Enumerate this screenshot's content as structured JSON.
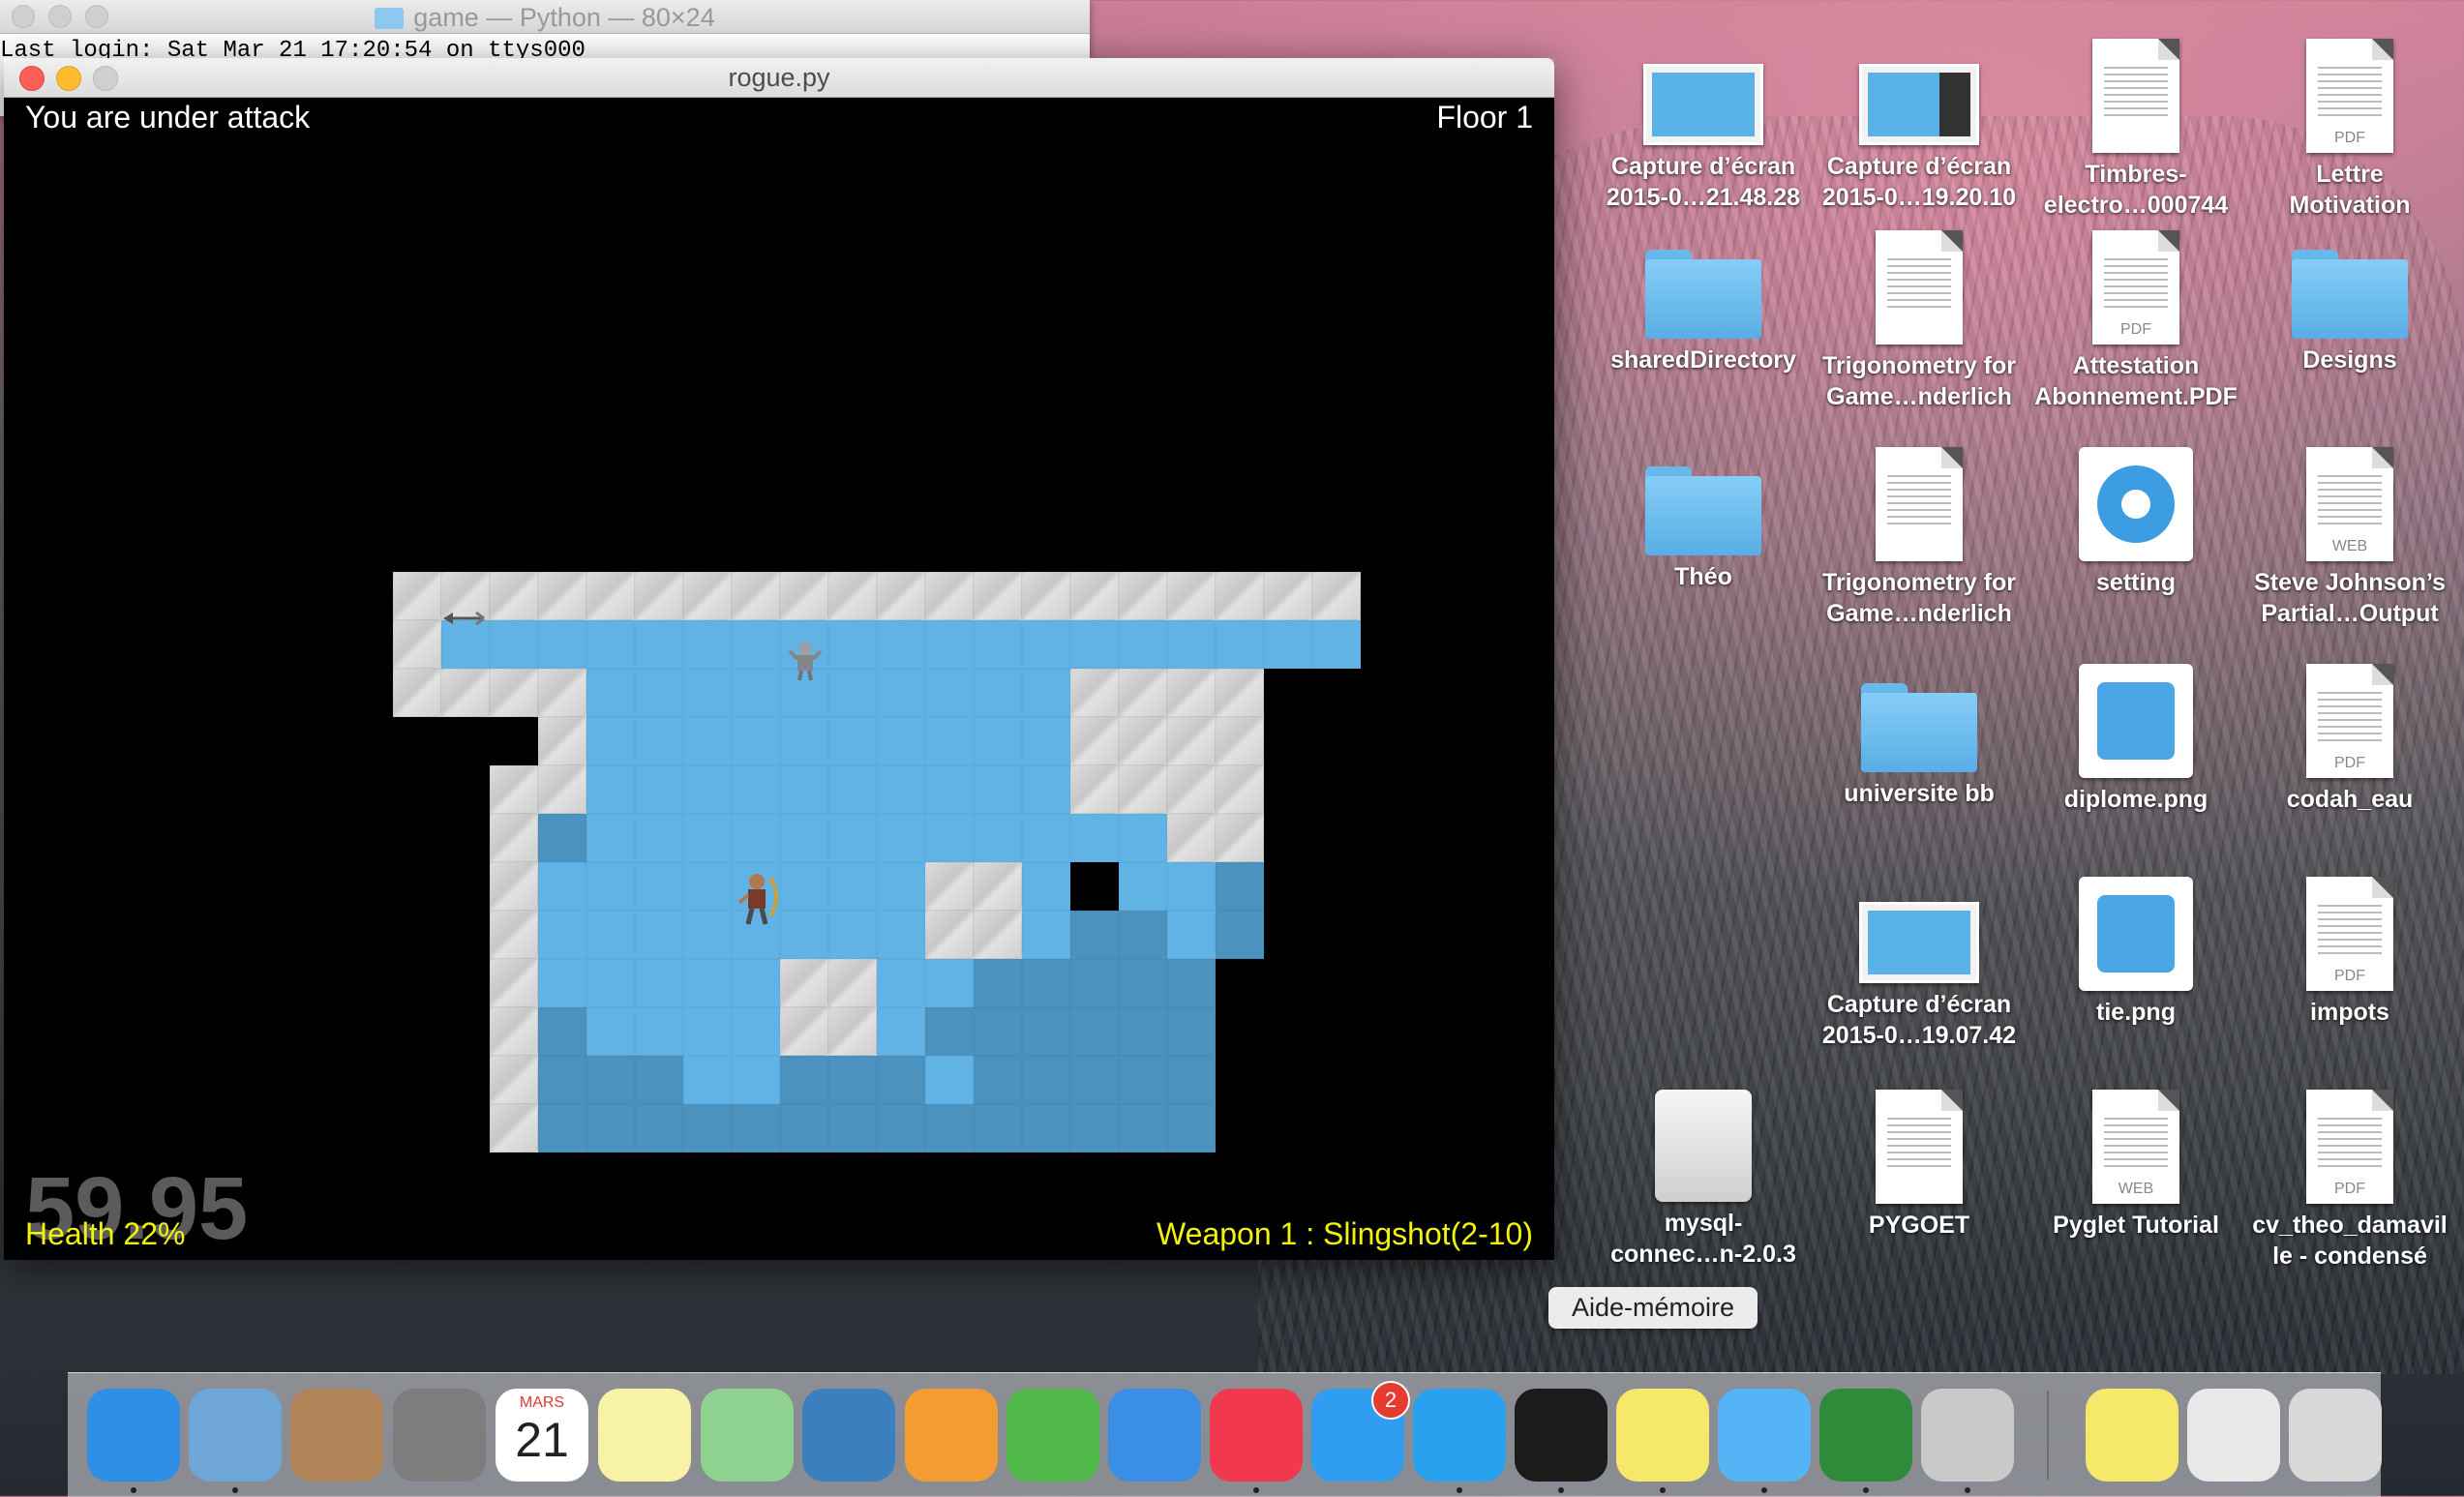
{
  "terminal": {
    "title": "game — Python — 80×24",
    "first_line": "Last login: Sat Mar 21 17:20:54 on ttys000"
  },
  "game_window": {
    "title": "rogue.py",
    "status_message": "You are under attack",
    "floor_label": "Floor 1",
    "health_label": "Health 22%",
    "weapon_label": "Weapon 1 : Slingshot(2-10)",
    "fps_label": "59.95",
    "colors": {
      "floor": "#60b3e4",
      "deep_floor": "#4b92bf",
      "wall": "#d2d2d2",
      "hud_yellow": "#f3f30a"
    },
    "map_rows": [
      "wwwwwwwwwwwwwwwwwwww",
      "wfffffffffffffffffff",
      "wwwwffffffffffwwww..",
      "...wffffffffffwwww..",
      "..wwffffffffffwwww..",
      "..wdffffffffffffww..",
      "..wffffffffwwfxffd..",
      "..wffffffffwwfddfd..",
      "..wfffffwwffddddd...",
      "..wdffffwwfdddddd...",
      "..wdddffdddfddddd...",
      "..wdddddddddddddd..."
    ]
  },
  "desktop_icons": [
    {
      "label": "Capture d’écran\n2015-0…21.48.28",
      "icon": "screenshot-icon"
    },
    {
      "label": "Capture d’écran\n2015-0…19.20.10",
      "icon": "screenshot-icon"
    },
    {
      "label": "Timbres-\nelectro…000744",
      "icon": "document-icon"
    },
    {
      "label": "Lettre\nMotivation",
      "icon": "pdf-icon",
      "tag": "PDF"
    },
    {
      "label": "sharedDirectory",
      "icon": "shared-folder-icon"
    },
    {
      "label": "Trigonometry for\nGame…nderlich",
      "icon": "document-icon"
    },
    {
      "label": "Attestation\nAbonnement.PDF",
      "icon": "pdf-icon",
      "tag": "PDF"
    },
    {
      "label": "Designs",
      "icon": "folder-icon"
    },
    {
      "label": "Théo",
      "icon": "folder-icon"
    },
    {
      "label": "Trigonometry for\nGame…nderlich",
      "icon": "document-icon"
    },
    {
      "label": "setting",
      "icon": "gear-icon"
    },
    {
      "label": "Steve Johnson’s\nPartial…Output",
      "icon": "web-icon",
      "tag": "WEB"
    },
    {
      "label": "universite bb",
      "icon": "folder-icon"
    },
    {
      "label": "diplome.png",
      "icon": "graduation-cap-icon"
    },
    {
      "label": "codah_eau",
      "icon": "pdf-icon",
      "tag": "PDF"
    },
    {
      "label": "Capture d’écran\n2015-0…19.07.42",
      "icon": "screenshot-icon"
    },
    {
      "label": "tie.png",
      "icon": "tie-icon"
    },
    {
      "label": "impots",
      "icon": "pdf-icon",
      "tag": "PDF"
    },
    {
      "label": "mysql-\nconnec…n-2.0.3",
      "icon": "drive-icon"
    },
    {
      "label": "PYGOET",
      "icon": "document-icon"
    },
    {
      "label": "Pyglet Tutorial",
      "icon": "web-icon",
      "tag": "WEB"
    },
    {
      "label": "cv_theo_damavil\nle - condensé",
      "icon": "pdf-icon",
      "tag": "PDF"
    }
  ],
  "tooltip": "Aide-mémoire",
  "dock": [
    {
      "name": "finder-icon",
      "color": "#2f8fe6",
      "running": true
    },
    {
      "name": "mail-icon",
      "color": "#6fa6d8",
      "running": true
    },
    {
      "name": "contacts-icon",
      "color": "#b18458",
      "running": false
    },
    {
      "name": "launchpad-icon",
      "color": "#7d7d7d",
      "running": false
    },
    {
      "name": "calendar-icon",
      "color": "#ffffff",
      "running": false,
      "month": "MARS",
      "day": "21"
    },
    {
      "name": "notes-icon",
      "color": "#f7f2a5",
      "running": false
    },
    {
      "name": "maps-icon",
      "color": "#8fd18f",
      "running": false
    },
    {
      "name": "photo-booth-icon",
      "color": "#3a7fbe",
      "running": false
    },
    {
      "name": "pages-icon",
      "color": "#f39c32",
      "running": false
    },
    {
      "name": "numbers-icon",
      "color": "#4fb848",
      "running": false
    },
    {
      "name": "keynote-icon",
      "color": "#3a8ee6",
      "running": false
    },
    {
      "name": "itunes-icon",
      "color": "#f2384f",
      "running": true
    },
    {
      "name": "app-store-icon",
      "color": "#2f9df0",
      "running": false,
      "badge": "2"
    },
    {
      "name": "safari-icon",
      "color": "#2aa1ef",
      "running": true
    },
    {
      "name": "terminal-icon",
      "color": "#1b1b1b",
      "running": true
    },
    {
      "name": "stickies-icon",
      "color": "#f5e86a",
      "running": true
    },
    {
      "name": "messages-icon",
      "color": "#55b4f5",
      "running": true
    },
    {
      "name": "vim-icon",
      "color": "#2d8b3a",
      "running": true
    },
    {
      "name": "python-launcher-icon",
      "color": "#c9c9c9",
      "running": true
    },
    {
      "name": "stickies-folder-icon",
      "color": "#f5e86a",
      "running": false
    },
    {
      "name": "downloads-stack-icon",
      "color": "#e8e8e8",
      "running": false
    },
    {
      "name": "trash-icon",
      "color": "#d8d8d8",
      "running": false
    }
  ]
}
